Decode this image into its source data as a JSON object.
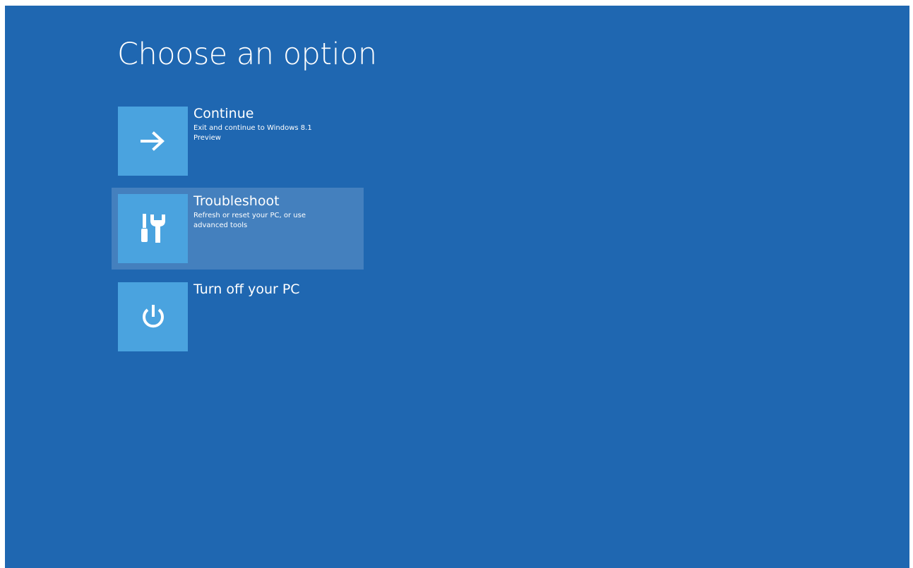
{
  "page": {
    "title": "Choose an option"
  },
  "options": [
    {
      "title": "Continue",
      "description": "Exit and continue to Windows 8.1 Preview",
      "icon": "arrow-right-icon",
      "selected": false
    },
    {
      "title": "Troubleshoot",
      "description": "Refresh or reset your PC, or use advanced tools",
      "icon": "tools-icon",
      "selected": true
    },
    {
      "title": "Turn off your PC",
      "description": "",
      "icon": "power-icon",
      "selected": false
    }
  ],
  "colors": {
    "background": "#1f67b1",
    "tile": "#4aa3df",
    "text": "#ffffff"
  }
}
